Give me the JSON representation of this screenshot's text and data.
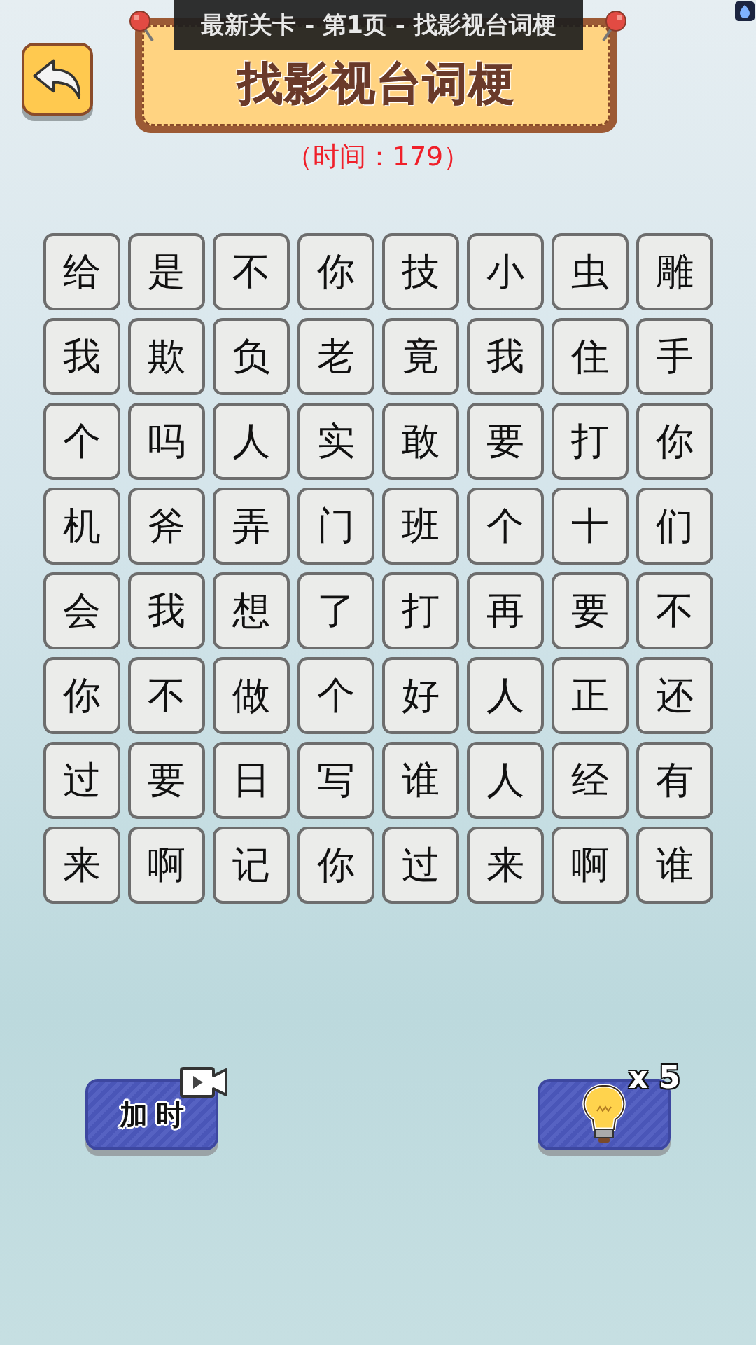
{
  "page_banner": "最新关卡 - 第1页 - 找影视台词梗",
  "title": "找影视台词梗",
  "timer": "（时间：179）",
  "grid": [
    [
      "给",
      "是",
      "不",
      "你",
      "技",
      "小",
      "虫",
      "雕"
    ],
    [
      "我",
      "欺",
      "负",
      "老",
      "竟",
      "我",
      "住",
      "手"
    ],
    [
      "个",
      "吗",
      "人",
      "实",
      "敢",
      "要",
      "打",
      "你"
    ],
    [
      "机",
      "斧",
      "弄",
      "门",
      "班",
      "个",
      "十",
      "们"
    ],
    [
      "会",
      "我",
      "想",
      "了",
      "打",
      "再",
      "要",
      "不"
    ],
    [
      "你",
      "不",
      "做",
      "个",
      "好",
      "人",
      "正",
      "还"
    ],
    [
      "过",
      "要",
      "日",
      "写",
      "谁",
      "人",
      "经",
      "有"
    ],
    [
      "来",
      "啊",
      "记",
      "你",
      "过",
      "来",
      "啊",
      "谁"
    ]
  ],
  "add_time_button": {
    "label": "加 时"
  },
  "hint_button": {
    "count": "x 5"
  }
}
